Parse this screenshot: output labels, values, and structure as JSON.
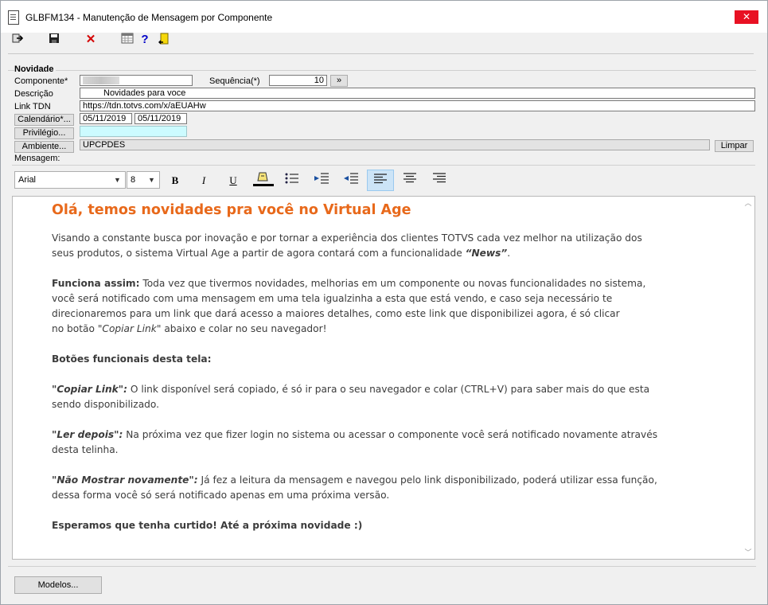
{
  "window": {
    "title": "GLBFM134 - Manutenção de Mensagem por Componente",
    "close_glyph": "✕"
  },
  "toolbar": {
    "icons": [
      "exit-icon",
      "save-icon",
      "delete-icon",
      "calendar-icon",
      "help-icon",
      "exit-door-icon"
    ],
    "delete_glyph": "✕",
    "help_glyph": "?"
  },
  "group": {
    "title": "Novidade"
  },
  "form": {
    "componente_label": "Componente*",
    "sequencia_label": "Sequência(*)",
    "sequencia_value": "10",
    "sequencia_button": "»",
    "descricao_label": "Descrição",
    "descricao_value": "Novidades para voce",
    "link_label": "Link TDN",
    "link_value": "https://tdn.totvs.com/x/aEUAHw",
    "calendario_button": "Calendário*...",
    "date_start": "05/11/2019",
    "date_end": "05/11/2019",
    "privilegio_button": "Privilégio...",
    "privilegio_value": "",
    "ambiente_button": "Ambiente...",
    "ambiente_value": "UPCPDES",
    "limpar_button": "Limpar",
    "mensagem_label": "Mensagem:"
  },
  "format_bar": {
    "font": "Arial",
    "size": "8",
    "bold": "B",
    "italic": "I",
    "underline": "U",
    "active_alignment": "align-left"
  },
  "message": {
    "heading": "Olá, temos novidades pra você no Virtual Age",
    "p1_line1": "Visando a constante busca por inovação e por tornar a experiência dos clientes TOTVS cada vez melhor na utilização dos",
    "p1_line2_a": "seus produtos, o sistema Virtual Age a partir de agora contará com a funcionalidade ",
    "p1_line2_b": "“News”",
    "p1_line2_c": ".",
    "p2_bold": "Funciona assim:",
    "p2_line1": " Toda vez que tivermos novidades, melhorias em um componente ou novas funcionalidades no sistema,",
    "p2_line2": "você será notificado com uma mensagem em uma tela igualzinha a esta que está vendo, e caso seja necessário te",
    "p2_line3": "direcionaremos para um link que dará acesso a maiores detalhes, como este link que disponibilizei agora, é só clicar",
    "p2_line4_a": "no botão ",
    "p2_line4_b": "\"Copiar Link\"",
    "p2_line4_c": " abaixo e colar no seu navegador!",
    "p3_bold": "Botões funcionais desta tela:",
    "p4_bold": "\"Copiar Link\":",
    "p4_line1": " O link disponível será copiado, é só ir para o seu navegador e colar (CTRL+V) para saber mais do que esta",
    "p4_line2": "sendo disponibilizado.",
    "p5_bold": "\"Ler depois\":",
    "p5_line1": " Na próxima vez que fizer login no sistema ou acessar o componente você será notificado novamente através",
    "p5_line2": "desta telinha.",
    "p6_bold": "\"Não Mostrar novamente\":",
    "p6_line1": " Já fez a leitura da mensagem e navegou pelo link disponibilizado, poderá utilizar essa função,",
    "p6_line2": "dessa forma você só será notificado apenas em uma próxima versão.",
    "p7_bold": "Esperamos que tenha curtido! Até a próxima novidade :)"
  },
  "footer": {
    "modelos_button": "Modelos..."
  }
}
